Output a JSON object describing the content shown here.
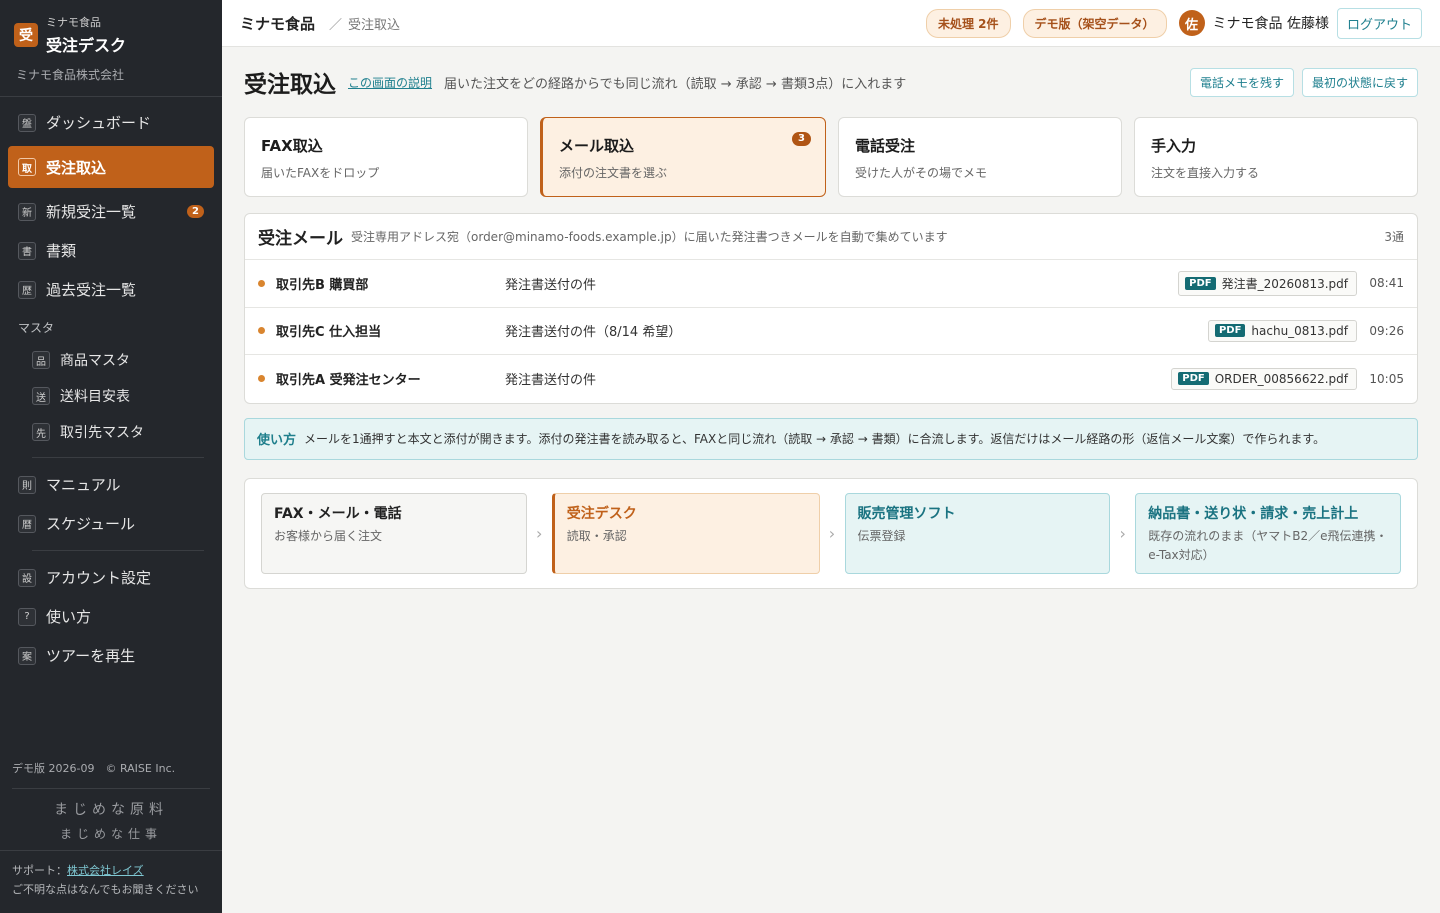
{
  "sidebar": {
    "logo_char": "受",
    "brand_sub": "ミナモ食品",
    "brand_title": "受注デスク",
    "company": "ミナモ食品株式会社",
    "items": [
      {
        "icon": "盤",
        "label": "ダッシュボード"
      },
      {
        "icon": "取",
        "label": "受注取込"
      },
      {
        "icon": "新",
        "label": "新規受注一覧",
        "count": "2"
      },
      {
        "icon": "書",
        "label": "書類"
      },
      {
        "icon": "歴",
        "label": "過去受注一覧"
      }
    ],
    "master_section": "マスタ",
    "master_items": [
      {
        "icon": "品",
        "label": "商品マスタ"
      },
      {
        "icon": "送",
        "label": "送料目安表"
      },
      {
        "icon": "先",
        "label": "取引先マスタ"
      }
    ],
    "items2": [
      {
        "icon": "則",
        "label": "マニュアル"
      },
      {
        "icon": "暦",
        "label": "スケジュール"
      }
    ],
    "items3": [
      {
        "icon": "設",
        "label": "アカウント設定"
      },
      {
        "icon": "?",
        "label": "使い方"
      },
      {
        "icon": "案",
        "label": "ツアーを再生"
      }
    ],
    "demo_version": "デモ版 2026-09　© RAISE Inc.",
    "motto1": "まじめな原料",
    "motto2": "まじめな仕事",
    "support_label": "サポート：",
    "support_link": "株式会社レイズ",
    "support_note": "ご不明な点はなんでもお聞きください"
  },
  "topbar": {
    "crumb_root": "ミナモ食品",
    "crumb_sep": "／",
    "crumb_current": "受注取込",
    "pending_pill": "未処理 2件",
    "demo_pill": "デモ版（架空データ）",
    "avatar_char": "佐",
    "user_name": "ミナモ食品 佐藤様",
    "logout": "ログアウト"
  },
  "page": {
    "title": "受注取込",
    "help_link": "この画面の説明",
    "description": "届いた注文をどの経路からでも同じ流れ（読取 → 承認 → 書類3点）に入れます",
    "btn_phone_memo": "電話メモを残す",
    "btn_reset": "最初の状態に戻す"
  },
  "cards": [
    {
      "title": "FAX取込",
      "sub": "届いたFAXをドロップ"
    },
    {
      "title": "メール取込",
      "sub": "添付の注文書を選ぶ",
      "badge": "3"
    },
    {
      "title": "電話受注",
      "sub": "受けた人がその場でメモ"
    },
    {
      "title": "手入力",
      "sub": "注文を直接入力する"
    }
  ],
  "mail": {
    "title": "受注メール",
    "note": "受注専用アドレス宛（order@minamo-foods.example.jp）に届いた発注書つきメールを自動で集めています",
    "count": "3通",
    "pdf_label": "PDF",
    "rows": [
      {
        "sender": "取引先B 購買部",
        "subject": "発注書送付の件",
        "file": "発注書_20260813.pdf",
        "time": "08:41"
      },
      {
        "sender": "取引先C 仕入担当",
        "subject": "発注書送付の件（8/14 希望）",
        "file": "hachu_0813.pdf",
        "time": "09:26"
      },
      {
        "sender": "取引先A 受発注センター",
        "subject": "発注書送付の件",
        "file": "ORDER_00856622.pdf",
        "time": "10:05"
      }
    ]
  },
  "howto": {
    "label": "使い方",
    "text": "メールを1通押すと本文と添付が開きます。添付の発注書を読み取ると、FAXと同じ流れ（読取 → 承認 → 書類）に合流します。返信だけはメール経路の形（返信メール文案）で作られます。"
  },
  "flow": [
    {
      "title": "FAX・メール・電話",
      "sub": "お客様から届く注文"
    },
    {
      "title": "受注デスク",
      "sub": "読取・承認"
    },
    {
      "title": "販売管理ソフト",
      "sub": "伝票登録"
    },
    {
      "title": "納品書・送り状・請求・売上計上",
      "sub": "既存の流れのまま（ヤマトB2／e飛伝連携・e-Tax対応）"
    }
  ],
  "colors": {
    "accent": "#c0611a",
    "teal": "#20808f",
    "sidebar_bg": "#24272c"
  }
}
